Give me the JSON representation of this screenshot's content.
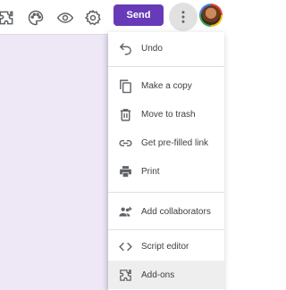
{
  "toolbar": {
    "icons": [
      "addons-puzzle-icon",
      "palette-icon",
      "eye-icon",
      "gear-icon"
    ],
    "send_label": "Send",
    "more_icon": "more-vert-icon"
  },
  "menu": {
    "items": [
      {
        "label": "Undo",
        "icon": "undo-icon"
      },
      {
        "label": "Make a copy",
        "icon": "copy-icon"
      },
      {
        "label": "Move to trash",
        "icon": "trash-icon"
      },
      {
        "label": "Get pre-filled link",
        "icon": "link-icon"
      },
      {
        "label": "Print",
        "icon": "print-icon"
      },
      {
        "label": "Add collaborators",
        "icon": "person-add-icon"
      },
      {
        "label": "Script editor",
        "icon": "code-icon"
      },
      {
        "label": "Add-ons",
        "icon": "puzzle-icon"
      }
    ]
  },
  "colors": {
    "accent": "#673ab7",
    "canvas": "#ede7f6",
    "menu_hover": "#eeeeee",
    "text": "#3c4043",
    "icon": "#5f6368"
  }
}
